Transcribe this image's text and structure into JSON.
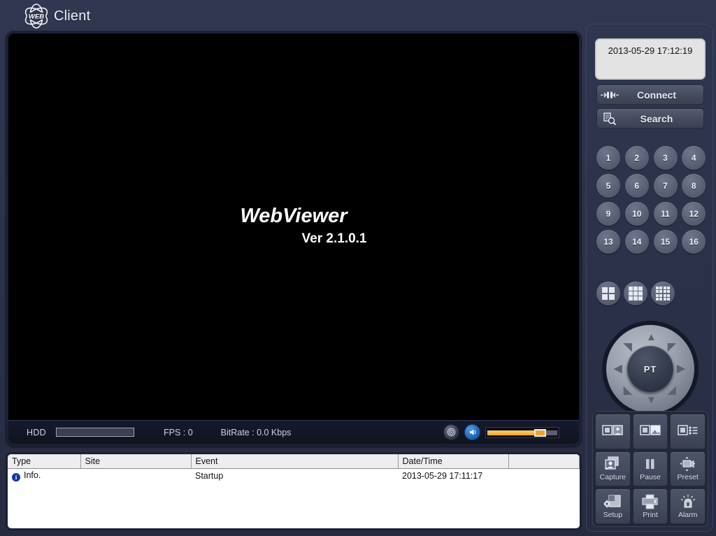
{
  "header": {
    "logo_badge": "WEB",
    "logo_icon": "web-atom-logo-icon",
    "title": "Client"
  },
  "video": {
    "brand_title": "WebViewer",
    "version": "Ver 2.1.0.1"
  },
  "status_bar": {
    "hdd_label": "HDD",
    "hdd_percent": 0,
    "fps_label": "FPS :  0",
    "bitrate_label": "BitRate :  0.0 Kbps",
    "mic_icon": "microphone-icon",
    "audio_icon": "speaker-icon",
    "volume_percent": 66
  },
  "event_log": {
    "columns": [
      "Type",
      "Site",
      "Event",
      "Date/Time",
      ""
    ],
    "rows": [
      {
        "icon": "info-icon",
        "type": "Info.",
        "site": "",
        "event": "Startup",
        "datetime": "2013-05-29 17:11:17"
      }
    ]
  },
  "side_panel": {
    "clock": "2013-05-29 17:12:19",
    "connect_button": {
      "label": "Connect",
      "icon": "plug-connector-icon"
    },
    "search_button": {
      "label": "Search",
      "icon": "document-search-icon"
    },
    "channels": [
      "1",
      "2",
      "3",
      "4",
      "5",
      "6",
      "7",
      "8",
      "9",
      "10",
      "11",
      "12",
      "13",
      "14",
      "15",
      "16"
    ],
    "layouts": [
      {
        "name": "layout-2x2",
        "cells": 4
      },
      {
        "name": "layout-3x3",
        "cells": 9
      },
      {
        "name": "layout-4x4",
        "cells": 16
      }
    ],
    "ptz": {
      "center_label": "PT",
      "directions": [
        "up",
        "up-right",
        "right",
        "down-right",
        "down",
        "down-left",
        "left",
        "up-left"
      ]
    },
    "tool_buttons": [
      {
        "name": "view-live-button",
        "label": "",
        "icon": "live-view-icon"
      },
      {
        "name": "view-image-button",
        "label": "",
        "icon": "image-view-icon"
      },
      {
        "name": "view-list-button",
        "label": "",
        "icon": "list-view-icon"
      },
      {
        "name": "capture-button",
        "label": "Capture",
        "icon": "capture-icon"
      },
      {
        "name": "pause-button",
        "label": "Pause",
        "icon": "pause-icon"
      },
      {
        "name": "preset-button",
        "label": "Preset",
        "icon": "camera-preset-icon"
      },
      {
        "name": "setup-button",
        "label": "Setup",
        "icon": "setup-gear-icon"
      },
      {
        "name": "print-button",
        "label": "Print",
        "icon": "printer-icon"
      },
      {
        "name": "alarm-button",
        "label": "Alarm",
        "icon": "alarm-bell-icon"
      }
    ]
  },
  "colors": {
    "background": "#2c3249",
    "panel": "#2f364f",
    "accent_orange": "#f4a12a",
    "accent_blue": "#1159a8",
    "screen": "#000000"
  }
}
